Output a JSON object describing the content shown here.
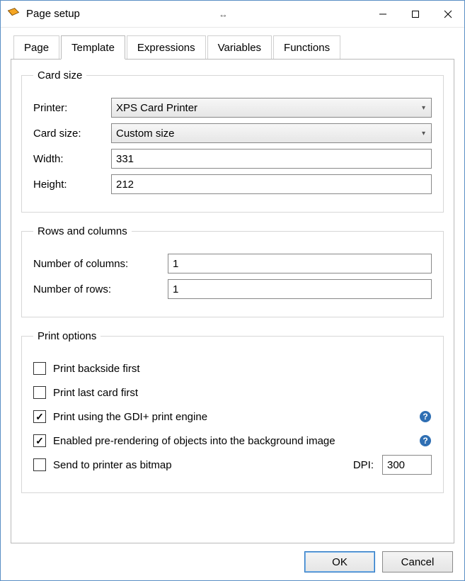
{
  "window": {
    "title": "Page setup"
  },
  "tabs": [
    "Page",
    "Template",
    "Expressions",
    "Variables",
    "Functions"
  ],
  "active_tab_index": 1,
  "card_size": {
    "legend": "Card size",
    "printer_label": "Printer:",
    "printer_value": "XPS Card Printer",
    "cardsize_label": "Card size:",
    "cardsize_value": "Custom size",
    "width_label": "Width:",
    "width_value": "331",
    "height_label": "Height:",
    "height_value": "212"
  },
  "rows_columns": {
    "legend": "Rows and columns",
    "cols_label": "Number of columns:",
    "cols_value": "1",
    "rows_label": "Number of rows:",
    "rows_value": "1"
  },
  "print_options": {
    "legend": "Print options",
    "backside_first": {
      "label": "Print backside first",
      "checked": false
    },
    "last_card_first": {
      "label": "Print last card first",
      "checked": false
    },
    "gdi_plus": {
      "label": "Print using the GDI+ print engine",
      "checked": true,
      "help": true
    },
    "prerender": {
      "label": "Enabled pre-rendering of objects into the background image",
      "checked": true,
      "help": true
    },
    "as_bitmap": {
      "label": "Send to printer as bitmap",
      "checked": false
    },
    "dpi_label": "DPI:",
    "dpi_value": "300"
  },
  "buttons": {
    "ok": "OK",
    "cancel": "Cancel"
  }
}
